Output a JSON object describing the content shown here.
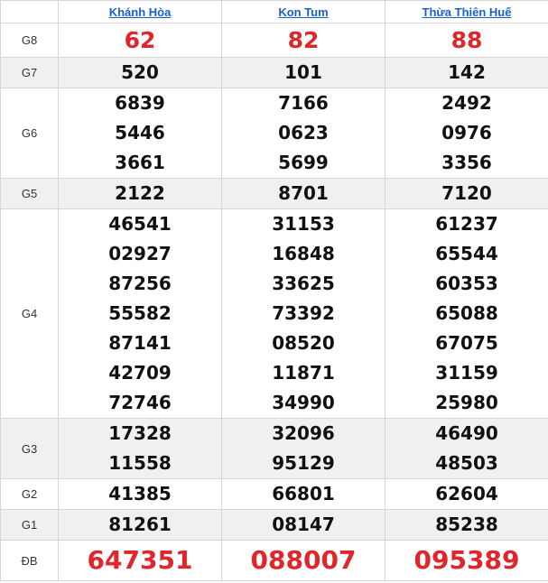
{
  "provinces": [
    "Khánh Hòa",
    "Kon Tum",
    "Thừa Thiên Huế"
  ],
  "colors": {
    "link": "#1a5fd1",
    "highlight": "#e0262b",
    "alt_row": "#f0f0f0"
  },
  "prizes": [
    {
      "label": "G8",
      "style": "big",
      "alt": false,
      "values": [
        [
          "62"
        ],
        [
          "82"
        ],
        [
          "88"
        ]
      ]
    },
    {
      "label": "G7",
      "style": "normal",
      "alt": true,
      "values": [
        [
          "520"
        ],
        [
          "101"
        ],
        [
          "142"
        ]
      ]
    },
    {
      "label": "G6",
      "style": "normal",
      "alt": false,
      "values": [
        [
          "6839",
          "5446",
          "3661"
        ],
        [
          "7166",
          "0623",
          "5699"
        ],
        [
          "2492",
          "0976",
          "3356"
        ]
      ]
    },
    {
      "label": "G5",
      "style": "normal",
      "alt": true,
      "values": [
        [
          "2122"
        ],
        [
          "8701"
        ],
        [
          "7120"
        ]
      ]
    },
    {
      "label": "G4",
      "style": "normal",
      "alt": false,
      "values": [
        [
          "46541",
          "02927",
          "87256",
          "55582",
          "87141",
          "42709",
          "72746"
        ],
        [
          "31153",
          "16848",
          "33625",
          "73392",
          "08520",
          "11871",
          "34990"
        ],
        [
          "61237",
          "65544",
          "60353",
          "65088",
          "67075",
          "31159",
          "25980"
        ]
      ]
    },
    {
      "label": "G3",
      "style": "normal",
      "alt": true,
      "values": [
        [
          "17328",
          "11558"
        ],
        [
          "32096",
          "95129"
        ],
        [
          "46490",
          "48503"
        ]
      ]
    },
    {
      "label": "G2",
      "style": "normal",
      "alt": false,
      "values": [
        [
          "41385"
        ],
        [
          "66801"
        ],
        [
          "62604"
        ]
      ]
    },
    {
      "label": "G1",
      "style": "normal",
      "alt": true,
      "values": [
        [
          "81261"
        ],
        [
          "08147"
        ],
        [
          "85238"
        ]
      ]
    },
    {
      "label": "ĐB",
      "style": "db",
      "alt": false,
      "values": [
        [
          "647351"
        ],
        [
          "088007"
        ],
        [
          "095389"
        ]
      ]
    }
  ]
}
